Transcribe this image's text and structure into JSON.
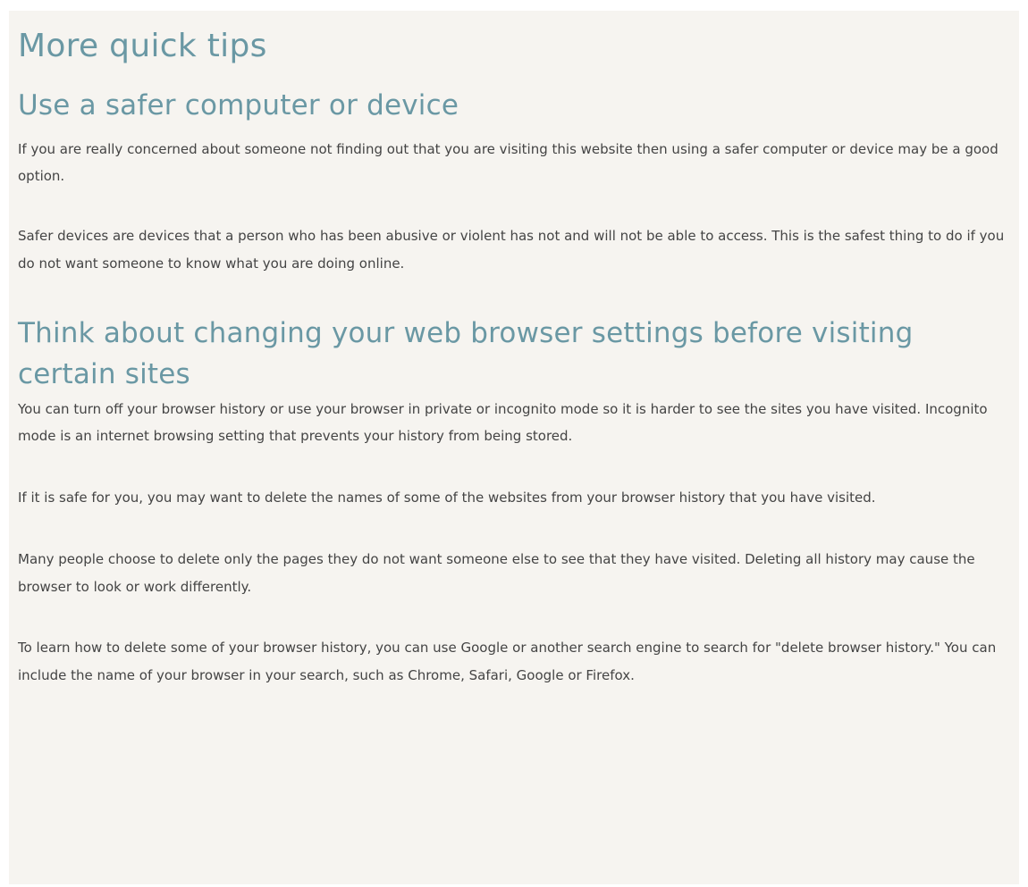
{
  "page": {
    "title": "More quick tips"
  },
  "sections": [
    {
      "heading": "Use a safer computer or device",
      "paragraphs": [
        "If you are really concerned about someone not finding out that you are visiting this website then using a safer computer or device may be a good option.",
        "Safer devices are devices that a person who has been abusive or violent has not and will not be able to access. This is the safest thing to do if you do not want someone to know what you are doing online."
      ]
    },
    {
      "heading": "Think about changing your web browser settings before visiting certain sites",
      "paragraphs": [
        "You can turn off your browser history or use your browser in private or incognito mode so it is harder to see the sites you have visited. Incognito mode is an internet browsing setting that prevents your history from being stored.",
        "If it is safe for you, you may want to delete the names of some of the websites from your browser history that you have visited.",
        "Many people choose to delete only the pages they do not want someone else to see that they have visited. Deleting all history may cause the browser to look or work differently.",
        "To learn how to delete some of your browser history, you can use Google or another search engine to search for \"delete browser history.\" You can include the name of your browser in your search, such as Chrome, Safari, Google or Firefox."
      ]
    }
  ],
  "colors": {
    "heading": "#6a98a4",
    "body_text": "#444444",
    "background": "#f6f4f0"
  }
}
